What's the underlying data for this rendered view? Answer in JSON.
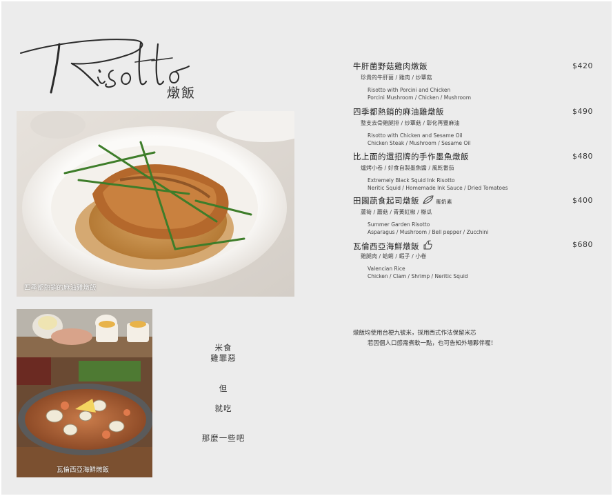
{
  "header": {
    "title_script": "Risotto",
    "title_cn": "燉飯"
  },
  "photos": {
    "main_caption": "四季都熱銷的麻油雞燉飯",
    "small_caption": "瓦倫西亞海鮮燉飯"
  },
  "slogan": {
    "line1": "米食",
    "line2": "雞罪惡",
    "line3": "但",
    "line4": "就吃",
    "line5": "那麼一些吧"
  },
  "menu": {
    "items": [
      {
        "name": "牛肝菌野菇雞肉燉飯",
        "price": "$420",
        "sub": "珍貴的牛肝菌 / 雞肉 / 炒蕈菇",
        "en1": "Risotto with Porcini and Chicken",
        "en2": "Porcini Mushroom / Chicken / Mushroom"
      },
      {
        "name": "四季都熱銷的麻油雞燉飯",
        "price": "$490",
        "sub": "整支去骨雞腿排 / 炒蕈菇 / 彰化再豐麻油",
        "en1": "Risotto with Chicken and Sesame Oil",
        "en2": "Chicken Steak / Mushroom / Sesame Oil"
      },
      {
        "name": "比上面的還招牌的手作墨魚燉飯",
        "price": "$480",
        "sub": "爐烤小卷 / 好食自製墨魚醬 / 風乾番茄",
        "en1": "Extremely Black Squid Ink Risotto",
        "en2": "Neritic Squid / Homemade Ink Sauce / Dried Tomatoes"
      },
      {
        "name": "田園蔬食起司燉飯",
        "price": "$400",
        "tag": "蛋奶素",
        "sub": "蘆筍 / 蘑菇 / 青黃紅椒 / 櫛瓜",
        "en1": "Summer Garden Risotto",
        "en2": "Asparagus / Mushroom / Bell pepper / Zucchini"
      },
      {
        "name": "瓦倫西亞海鮮燉飯",
        "price": "$680",
        "sub": "雞腿肉 / 蛤蜊 / 蝦子 / 小卷",
        "en1": "Valencian Rice",
        "en2": "Chicken / Clam / Shrimp / Neritic Squid"
      }
    ]
  },
  "note": {
    "line1": "燉飯均使用台梗九號米，採用西式作法保留米芯",
    "line2": "若因個人口感需煮軟一點，也可告知外場夥伴喔！"
  },
  "icons": {
    "vegetarian": "leaf-icon",
    "recommended": "thumbs-up-icon"
  },
  "colors": {
    "background": "#ececec",
    "text": "#333333"
  }
}
